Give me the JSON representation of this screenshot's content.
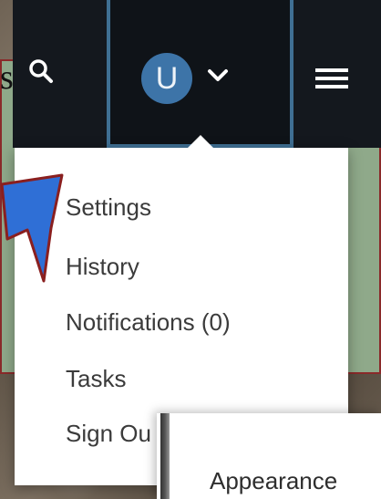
{
  "slide": {
    "partial_text": "st"
  },
  "navbar": {
    "avatar_initial": "U",
    "search_icon": "search-icon",
    "chevron_icon": "chevron-down-icon",
    "menu_icon": "hamburger-menu-icon"
  },
  "dropdown": {
    "items": [
      {
        "label": "Settings"
      },
      {
        "label": "History"
      },
      {
        "label": "Notifications (0)"
      },
      {
        "label": "Tasks"
      },
      {
        "label": "Sign Ou"
      }
    ]
  },
  "appearance_panel": {
    "label": "Appearance"
  },
  "colors": {
    "navbar_bg": "#14181e",
    "avatar_bg": "#3d74a8",
    "highlight_border": "#3f6f93",
    "callout_fill": "#2f6fd6",
    "callout_border": "#8a1f1f"
  }
}
